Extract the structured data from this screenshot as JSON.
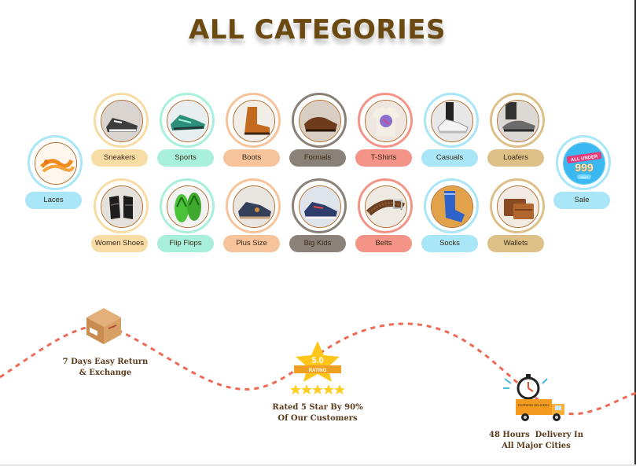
{
  "page": {
    "title": "ALL CATEGORIES"
  },
  "colors": {
    "title": "#6b4a12",
    "yellow": "#f8dca5",
    "mint": "#a8f0dc",
    "peach": "#f7c39b",
    "gray": "#8a8178",
    "salmon": "#f39487",
    "sky": "#a9e6f7",
    "tan": "#ddc088",
    "wave": "#ee6a55"
  },
  "categories": {
    "laces": {
      "label": "Laces",
      "icon": "laces-photo"
    },
    "sale": {
      "label": "Sale",
      "icon": "sale-badge",
      "badge_line1": "ALL UNDER",
      "badge_line2": "999",
      "badge_line3": "ONLY"
    },
    "row1": [
      {
        "label": "Sneakers",
        "icon": "sneakers-photo"
      },
      {
        "label": "Sports",
        "icon": "sports-shoes-photo"
      },
      {
        "label": "Boots",
        "icon": "boots-photo"
      },
      {
        "label": "Formals",
        "icon": "formal-shoes-photo"
      },
      {
        "label": "T-Shirts",
        "icon": "tshirt-photo"
      },
      {
        "label": "Casuals",
        "icon": "casual-shoes-photo"
      },
      {
        "label": "Loafers",
        "icon": "loafers-photo"
      }
    ],
    "row2": [
      {
        "label": "Women Shoes",
        "icon": "women-shoes-photo"
      },
      {
        "label": "Flip Flops",
        "icon": "flip-flops-photo"
      },
      {
        "label": "Plus Size",
        "icon": "plus-size-photo"
      },
      {
        "label": "Big Kids",
        "icon": "kids-shoes-photo"
      },
      {
        "label": "Belts",
        "icon": "belts-photo"
      },
      {
        "label": "Socks",
        "icon": "socks-photo"
      },
      {
        "label": "Wallets",
        "icon": "wallets-photo"
      }
    ]
  },
  "features": {
    "returns": {
      "line1": "7 Days Easy Return",
      "line2": "& Exchange",
      "icon": "box-icon"
    },
    "rating": {
      "line1": "Rated 5 Star By 90%",
      "line2": "Of Our Customers",
      "icon": "star-rating-icon",
      "score": "5.0",
      "score_label": "RATING",
      "stars": 5
    },
    "delivery": {
      "line1": "48 Hours  Delivery In",
      "line2": "All Major Cities",
      "icon": "delivery-truck-icon",
      "truck_label": "EXPRESS DELIVERY"
    }
  }
}
